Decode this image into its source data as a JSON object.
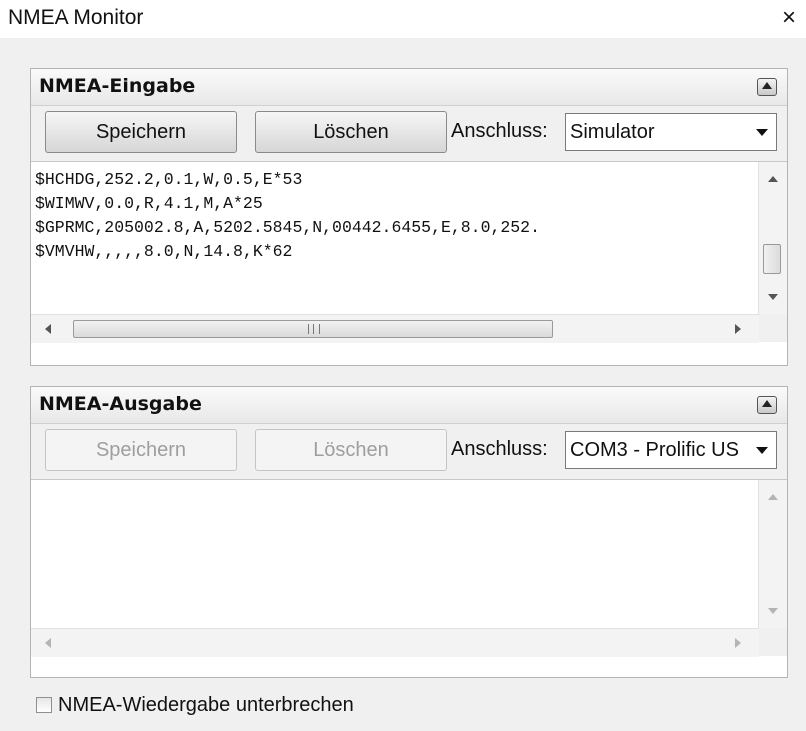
{
  "window": {
    "title": "NMEA Monitor",
    "close_glyph": "×"
  },
  "input_panel": {
    "title": "NMEA-Eingabe",
    "save_label": "Speichern",
    "clear_label": "Löschen",
    "port_label": "Anschluss:",
    "port_value": "Simulator",
    "buttons_enabled": true,
    "lines": [
      "$HCHDG,252.2,0.1,W,0.5,E*53",
      "$WIMWV,0.0,R,4.1,M,A*25",
      "$GPRMC,205002.8,A,5202.5845,N,00442.6455,E,8.0,252.",
      "$VMVHW,,,,,8.0,N,14.8,K*62"
    ]
  },
  "output_panel": {
    "title": "NMEA-Ausgabe",
    "save_label": "Speichern",
    "clear_label": "Löschen",
    "port_label": "Anschluss:",
    "port_value": "COM3 - Prolific US",
    "buttons_enabled": false,
    "lines": []
  },
  "pause_checkbox": {
    "label": "NMEA-Wiedergabe unterbrechen",
    "checked": false
  },
  "icons": {
    "collapse": "chevron-up-icon",
    "dropdown": "dropdown-arrow-icon",
    "close": "close-icon"
  }
}
